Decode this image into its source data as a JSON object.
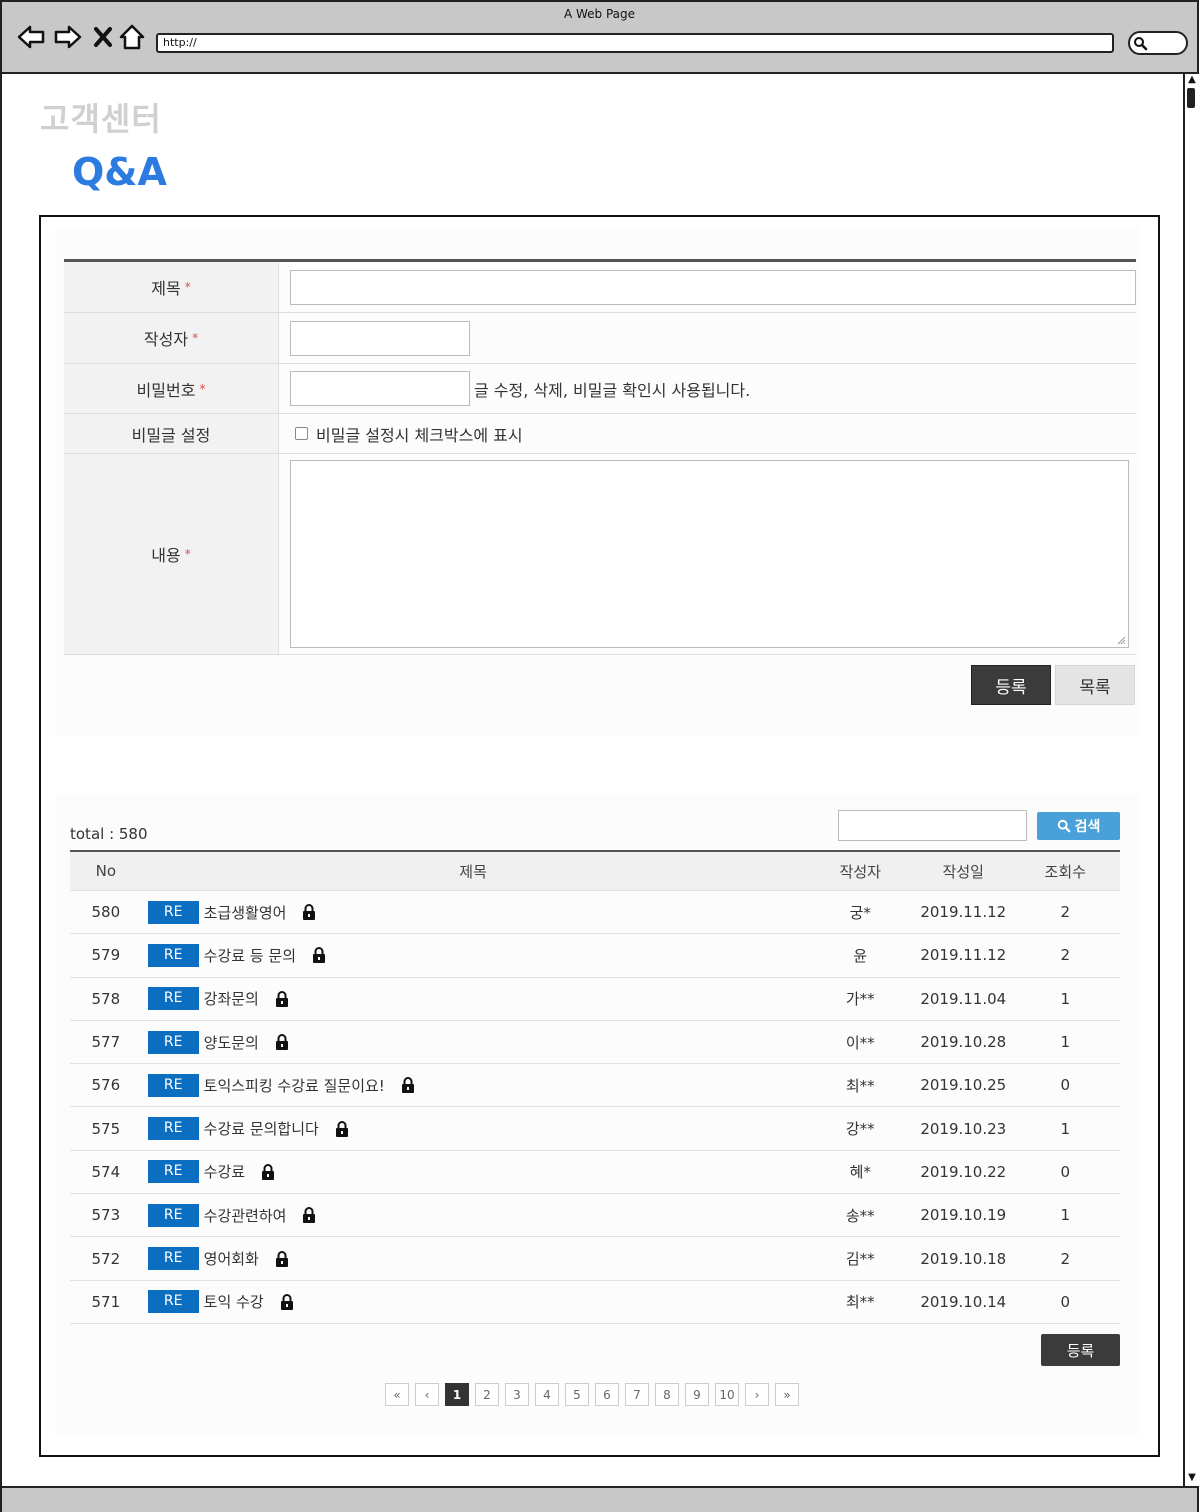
{
  "browser": {
    "window_title": "A Web Page",
    "url": "http://"
  },
  "header": {
    "section_title": "고객센터",
    "page_title": "Q&A"
  },
  "form": {
    "required_mark": "*",
    "title_label": "제목",
    "author_label": "작성자",
    "password_label": "비밀번호",
    "password_hint": "글 수정, 삭제, 비밀글 확인시 사용됩니다.",
    "secret_label": "비밀글 설정",
    "secret_checkbox_text": "비밀글 설정시 체크박스에 표시",
    "content_label": "내용",
    "submit_label": "등록",
    "list_label": "목록"
  },
  "list": {
    "total_text": "total : 580",
    "search_button_label": "검색",
    "columns": [
      "No",
      "제목",
      "작성자",
      "작성일",
      "조회수"
    ],
    "re_badge": "RE",
    "rows": [
      {
        "no": "580",
        "title": "초급생활영어",
        "author": "궁*",
        "date": "2019.11.12",
        "views": "2"
      },
      {
        "no": "579",
        "title": "수강료 등 문의",
        "author": "윤",
        "date": "2019.11.12",
        "views": "2"
      },
      {
        "no": "578",
        "title": "강좌문의",
        "author": "가**",
        "date": "2019.11.04",
        "views": "1"
      },
      {
        "no": "577",
        "title": "양도문의",
        "author": "이**",
        "date": "2019.10.28",
        "views": "1"
      },
      {
        "no": "576",
        "title": "토익스피킹 수강료 질문이요!",
        "author": "최**",
        "date": "2019.10.25",
        "views": "0"
      },
      {
        "no": "575",
        "title": "수강료 문의합니다",
        "author": "강**",
        "date": "2019.10.23",
        "views": "1"
      },
      {
        "no": "574",
        "title": "수강료",
        "author": "혜*",
        "date": "2019.10.22",
        "views": "0"
      },
      {
        "no": "573",
        "title": "수강관련하여",
        "author": "송**",
        "date": "2019.10.19",
        "views": "1"
      },
      {
        "no": "572",
        "title": "영어회화",
        "author": "김**",
        "date": "2019.10.18",
        "views": "2"
      },
      {
        "no": "571",
        "title": "토익 수강",
        "author": "최**",
        "date": "2019.10.14",
        "views": "0"
      }
    ],
    "register_label": "등록",
    "pagination": [
      "«",
      "‹",
      "1",
      "2",
      "3",
      "4",
      "5",
      "6",
      "7",
      "8",
      "9",
      "10",
      "›",
      "»"
    ],
    "current_page": "1"
  },
  "colors": {
    "accent_blue": "#2b7be0",
    "badge_blue": "#0b6ec0",
    "search_blue": "#4aa0d8",
    "dark_button": "#3b3b3b",
    "required_red": "#e04a4a"
  },
  "icons": [
    "back-arrow-icon",
    "forward-arrow-icon",
    "close-x-icon",
    "home-icon",
    "search-icon",
    "lock-icon",
    "resize-grip-icon"
  ]
}
